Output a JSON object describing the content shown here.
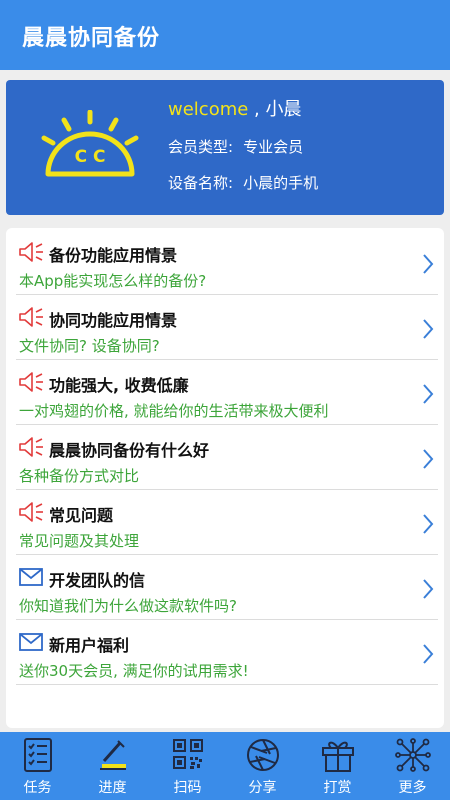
{
  "app": {
    "title": "晨晨协同备份"
  },
  "profile": {
    "welcome_word": "welcome",
    "welcome_rest": " , 小晨",
    "member_key": "会员类型:",
    "member_value": "专业会员",
    "device_key": "设备名称:",
    "device_value": "小晨的手机",
    "logo_letters": "C C"
  },
  "items": [
    {
      "icon": "speaker-icon",
      "title": "备份功能应用情景",
      "subtitle": "本App能实现怎么样的备份?"
    },
    {
      "icon": "speaker-icon",
      "title": "协同功能应用情景",
      "subtitle": "文件协同? 设备协同?"
    },
    {
      "icon": "speaker-icon",
      "title": "功能强大, 收费低廉",
      "subtitle": "一对鸡翅的价格, 就能给你的生活带来极大便利"
    },
    {
      "icon": "speaker-icon",
      "title": "晨晨协同备份有什么好",
      "subtitle": "各种备份方式对比"
    },
    {
      "icon": "speaker-icon",
      "title": "常见问题",
      "subtitle": "常见问题及其处理"
    },
    {
      "icon": "envelope-icon",
      "title": "开发团队的信",
      "subtitle": "你知道我们为什么做这款软件吗?"
    },
    {
      "icon": "envelope-icon",
      "title": "新用户福利",
      "subtitle": "送你30天会员, 满足你的试用需求!"
    }
  ],
  "tabs": [
    {
      "icon": "checklist-icon",
      "label": "任务"
    },
    {
      "icon": "progress-icon",
      "label": "进度"
    },
    {
      "icon": "qr-code-icon",
      "label": "扫码"
    },
    {
      "icon": "aperture-icon",
      "label": "分享"
    },
    {
      "icon": "gift-icon",
      "label": "打赏"
    },
    {
      "icon": "network-icon",
      "label": "更多"
    }
  ],
  "colors": {
    "primary": "#3a8ce9",
    "card": "#2f69c8",
    "accent_yellow": "#f2e21a",
    "subtitle_green": "#3da53a",
    "speaker_red": "#e23b3b"
  }
}
